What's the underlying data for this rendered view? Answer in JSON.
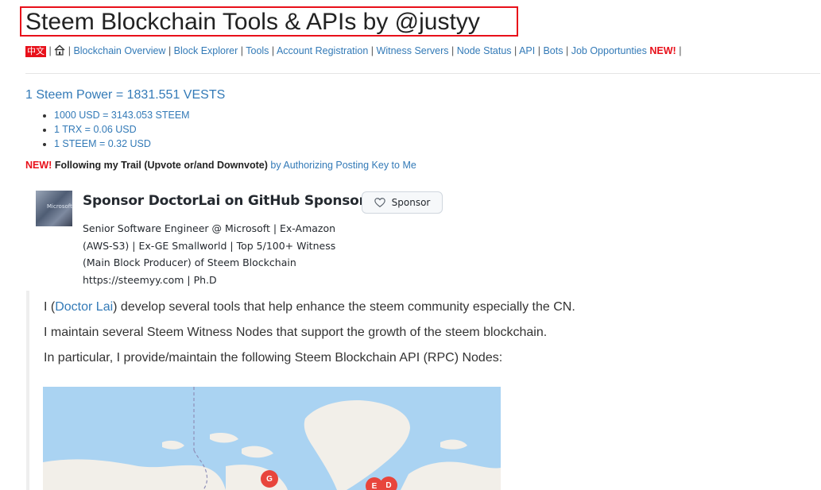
{
  "header": {
    "title": "Steem Blockchain Tools & APIs by @justyy"
  },
  "nav": {
    "lang": "中文",
    "separator": "|",
    "home_icon": "home-icon",
    "items": [
      {
        "label": "Blockchain Overview"
      },
      {
        "label": "Block Explorer"
      },
      {
        "label": "Tools"
      },
      {
        "label": "Account Registration"
      },
      {
        "label": "Witness Servers"
      },
      {
        "label": "Node Status"
      },
      {
        "label": "API"
      },
      {
        "label": "Bots"
      },
      {
        "label": "Job Opportunties"
      }
    ],
    "new_badge": "NEW!"
  },
  "conversion": {
    "steem_power": "1 Steem Power = 1831.551 VESTS",
    "rates": [
      "1000 USD = 3143.053 STEEM",
      "1 TRX = 0.06 USD",
      "1 STEEM = 0.32 USD"
    ]
  },
  "trail": {
    "new_badge": "NEW!",
    "bold_text": "Following my Trail (Upvote or/and Downvote)",
    "link_text": "by Authorizing Posting Key to Me"
  },
  "sponsor": {
    "avatar_text": "Microsoft",
    "title": "Sponsor DoctorLai on GitHub Sponsors",
    "button_label": "Sponsor",
    "bio_lines": [
      "Senior Software Engineer @ Microsoft | Ex-Amazon",
      "(AWS-S3) | Ex-GE Smallworld | Top 5/100+ Witness",
      "(Main Block Producer) of Steem Blockchain",
      "https://steemyy.com | Ph.D"
    ]
  },
  "intro": {
    "p1_prefix": "I (",
    "p1_link": "Doctor Lai",
    "p1_suffix": ") develop several tools that help enhance the steem community especially the CN.",
    "p2": "I maintain several Steem Witness Nodes that support the growth of the steem blockchain.",
    "p3": "In particular, I provide/maintain the following Steem Blockchain API (RPC) Nodes:"
  },
  "map": {
    "markers": [
      "G",
      "E",
      "D"
    ],
    "colors": {
      "water": "#aad3f2",
      "land": "#f2efe9",
      "marker": "#e8453c"
    }
  }
}
